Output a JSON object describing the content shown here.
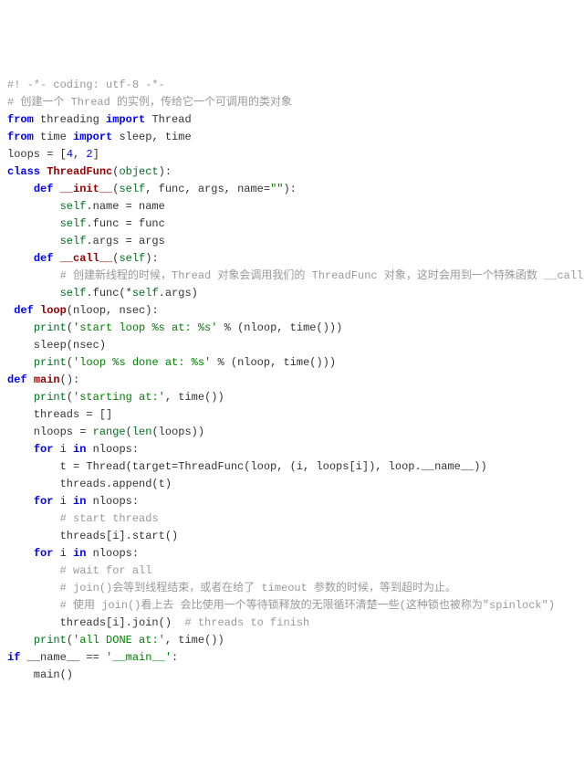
{
  "code": {
    "l1": {
      "t1": "#! -*- coding: utf-8 -*-"
    },
    "l2": {
      "t1": "# 创建一个 Thread 的实例，传给它一个可调用的类对象"
    },
    "l3": {
      "t1": "from",
      "t2": " threading ",
      "t3": "import",
      "t4": " Thread"
    },
    "l4": {
      "t1": "from",
      "t2": " time ",
      "t3": "import",
      "t4": " sleep, time"
    },
    "l5": {
      "t1": "loops = [",
      "t2": "4",
      "t3": ", ",
      "t4": "2",
      "t5": "]"
    },
    "l6": {
      "t1": "class",
      "t2": " ",
      "t3": "ThreadFunc",
      "t4": "(",
      "t5": "object",
      "t6": "):"
    },
    "l7": {
      "t1": "    ",
      "t2": "def",
      "t3": " ",
      "t4": "__init__",
      "t5": "(",
      "t6": "self",
      "t7": ", func, args, name=",
      "t8": "\"\"",
      "t9": "):"
    },
    "l8": {
      "t1": "        ",
      "t2": "self",
      "t3": ".name = name"
    },
    "l9": {
      "t1": "        ",
      "t2": "self",
      "t3": ".func = func"
    },
    "l10": {
      "t1": "        ",
      "t2": "self",
      "t3": ".args = args"
    },
    "l11": {
      "t1": "    ",
      "t2": "def",
      "t3": " ",
      "t4": "__call__",
      "t5": "(",
      "t6": "self",
      "t7": "):"
    },
    "l12": {
      "t1": "        ",
      "t2": "# 创建新线程的时候，Thread 对象会调用我们的 ThreadFunc 对象，这时会用到一个特殊函数 __call__()。"
    },
    "l13": {
      "t1": "        ",
      "t2": "self",
      "t3": ".func(*",
      "t4": "self",
      "t5": ".args)"
    },
    "l14": {
      "t1": " ",
      "t2": "def",
      "t3": " ",
      "t4": "loop",
      "t5": "(nloop, nsec):"
    },
    "l15": {
      "t1": "    ",
      "t2": "print",
      "t3": "(",
      "t4": "'start loop %s at: %s'",
      "t5": " % (nloop, time()))"
    },
    "l16": {
      "t1": "    sleep(nsec)"
    },
    "l17": {
      "t1": "    ",
      "t2": "print",
      "t3": "(",
      "t4": "'loop %s done at: %s'",
      "t5": " % (nloop, time()))"
    },
    "l18": {
      "t1": "def",
      "t2": " ",
      "t3": "main",
      "t4": "():"
    },
    "l19": {
      "t1": "    ",
      "t2": "print",
      "t3": "(",
      "t4": "'starting at:'",
      "t5": ", time())"
    },
    "l20": {
      "t1": "    threads = []"
    },
    "l21": {
      "t1": "    nloops = ",
      "t2": "range",
      "t3": "(",
      "t4": "len",
      "t5": "(loops))"
    },
    "l22": {
      "t1": "    ",
      "t2": "for",
      "t3": " i ",
      "t4": "in",
      "t5": " nloops:"
    },
    "l23": {
      "t1": "        t = Thread(target=ThreadFunc(loop, (i, loops[i]), loop.__name__))"
    },
    "l24": {
      "t1": "        threads.append(t)"
    },
    "l25": {
      "t1": "    ",
      "t2": "for",
      "t3": " i ",
      "t4": "in",
      "t5": " nloops:"
    },
    "l26": {
      "t1": "        ",
      "t2": "# start threads"
    },
    "l27": {
      "t1": "        threads[i].start()"
    },
    "l28": {
      "t1": "    ",
      "t2": "for",
      "t3": " i ",
      "t4": "in",
      "t5": " nloops:"
    },
    "l29": {
      "t1": "        ",
      "t2": "# wait for all"
    },
    "l30": {
      "t1": "        ",
      "t2": "# join()会等到线程结束，或者在给了 timeout 参数的时候，等到超时为止。"
    },
    "l31": {
      "t1": "        ",
      "t2": "# 使用 join()看上去 会比使用一个等待锁释放的无限循环清楚一些(这种锁也被称为\"spinlock\")"
    },
    "l32": {
      "t1": "        threads[i].join()  ",
      "t2": "# threads to finish"
    },
    "l33": {
      "t1": "    ",
      "t2": "print",
      "t3": "(",
      "t4": "'all DONE at:'",
      "t5": ", time())"
    },
    "l34": {
      "t1": "if",
      "t2": " __name__ == ",
      "t3": "'__main__'",
      "t4": ":"
    },
    "l35": {
      "t1": "    main()"
    }
  }
}
